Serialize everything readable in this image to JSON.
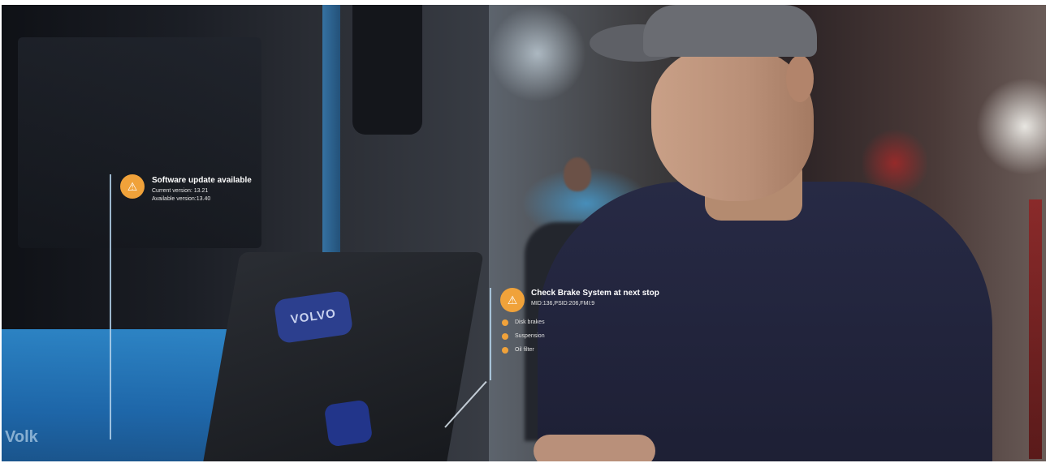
{
  "overlay": {
    "software_update": {
      "title": "Software update available",
      "current_version": "Current version: 13.21",
      "available_version": "Available version:13.40",
      "badge_icon": "warning-icon"
    },
    "brake_check": {
      "title": "Check Brake System at next stop",
      "codes": "MID:136,PSID:206,FMI:9",
      "badge_icon": "warning-icon",
      "items": [
        "Disk brakes",
        "Suspension",
        "Oil filter"
      ]
    }
  },
  "scene": {
    "laptop_logo_text": "VOLVO",
    "bus_text": "Volk"
  },
  "colors": {
    "badge": "#f0a23a",
    "accent_line": "#b4d2eb",
    "shirt": "#23263f"
  }
}
